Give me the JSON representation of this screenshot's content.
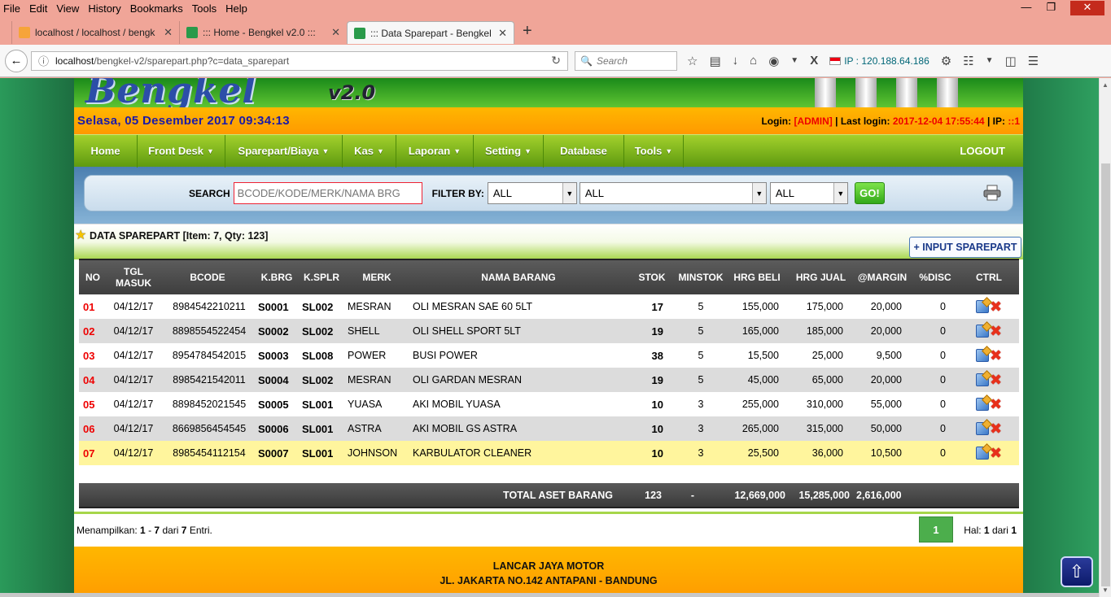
{
  "browser": {
    "menu": [
      "File",
      "Edit",
      "View",
      "History",
      "Bookmarks",
      "Tools",
      "Help"
    ],
    "tabs": [
      {
        "title": "localhost / localhost / bengk",
        "active": false
      },
      {
        "title": "::: Home - Bengkel v2.0 :::",
        "active": false
      },
      {
        "title": "::: Data Sparepart - Bengkel v",
        "active": true
      }
    ],
    "url_host": "localhost",
    "url_path": "/bengkel-v2/sparepart.php?c=data_sparepart",
    "search_placeholder": "Search",
    "ip_label": "IP : 120.188.64.186"
  },
  "header": {
    "logo": "Bengkel",
    "version": "v2.0",
    "datetime": "Selasa, 05 Desember 2017  09:34:13",
    "login_label": "Login:",
    "login_user": "[ADMIN]",
    "last_login_label": "| Last login:",
    "last_login": "2017-12-04 17:55:44",
    "ip_label": "| IP:",
    "ip": "::1"
  },
  "menu": {
    "items": [
      {
        "label": "Home",
        "dropdown": false
      },
      {
        "label": "Front Desk",
        "dropdown": true
      },
      {
        "label": "Sparepart/Biaya",
        "dropdown": true
      },
      {
        "label": "Kas",
        "dropdown": true
      },
      {
        "label": "Laporan",
        "dropdown": true
      },
      {
        "label": "Setting",
        "dropdown": true
      },
      {
        "label": "Database",
        "dropdown": false
      },
      {
        "label": "Tools",
        "dropdown": true
      }
    ],
    "logout": "LOGOUT"
  },
  "search": {
    "label": "SEARCH",
    "placeholder": "BCODE/KODE/MERK/NAMA BRG",
    "filter_label": "FILTER BY:",
    "filter1": "ALL",
    "filter2": "ALL",
    "filter3": "ALL",
    "go": "GO!"
  },
  "section": {
    "title": "DATA SPAREPART [Item: 7, Qty: 123]",
    "input_button": "+ INPUT SPAREPART"
  },
  "table": {
    "headers": [
      "NO",
      "TGL MASUK",
      "BCODE",
      "K.BRG",
      "K.SPLR",
      "MERK",
      "NAMA BARANG",
      "STOK",
      "MINSTOK",
      "HRG BELI",
      "HRG JUAL",
      "@MARGIN",
      "%DISC",
      "CTRL"
    ],
    "rows": [
      {
        "no": "01",
        "tgl": "04/12/17",
        "bcode": "8984542210211",
        "kbrg": "S0001",
        "ksplr": "SL002",
        "merk": "MESRAN",
        "nama": "OLI MESRAN SAE 60 5LT",
        "stok": "17",
        "minstok": "5",
        "beli": "155,000",
        "jual": "175,000",
        "margin": "20,000",
        "disc": "0"
      },
      {
        "no": "02",
        "tgl": "04/12/17",
        "bcode": "8898554522454",
        "kbrg": "S0002",
        "ksplr": "SL002",
        "merk": "SHELL",
        "nama": "OLI SHELL SPORT 5LT",
        "stok": "19",
        "minstok": "5",
        "beli": "165,000",
        "jual": "185,000",
        "margin": "20,000",
        "disc": "0"
      },
      {
        "no": "03",
        "tgl": "04/12/17",
        "bcode": "8954784542015",
        "kbrg": "S0003",
        "ksplr": "SL008",
        "merk": "POWER",
        "nama": "BUSI POWER",
        "stok": "38",
        "minstok": "5",
        "beli": "15,500",
        "jual": "25,000",
        "margin": "9,500",
        "disc": "0"
      },
      {
        "no": "04",
        "tgl": "04/12/17",
        "bcode": "8985421542011",
        "kbrg": "S0004",
        "ksplr": "SL002",
        "merk": "MESRAN",
        "nama": "OLI GARDAN MESRAN",
        "stok": "19",
        "minstok": "5",
        "beli": "45,000",
        "jual": "65,000",
        "margin": "20,000",
        "disc": "0"
      },
      {
        "no": "05",
        "tgl": "04/12/17",
        "bcode": "8898452021545",
        "kbrg": "S0005",
        "ksplr": "SL001",
        "merk": "YUASA",
        "nama": "AKI MOBIL YUASA",
        "stok": "10",
        "minstok": "3",
        "beli": "255,000",
        "jual": "310,000",
        "margin": "55,000",
        "disc": "0"
      },
      {
        "no": "06",
        "tgl": "04/12/17",
        "bcode": "8669856454545",
        "kbrg": "S0006",
        "ksplr": "SL001",
        "merk": "ASTRA",
        "nama": "AKI MOBIL GS ASTRA",
        "stok": "10",
        "minstok": "3",
        "beli": "265,000",
        "jual": "315,000",
        "margin": "50,000",
        "disc": "0"
      },
      {
        "no": "07",
        "tgl": "04/12/17",
        "bcode": "8985454112154",
        "kbrg": "S0007",
        "ksplr": "SL001",
        "merk": "JOHNSON",
        "nama": "KARBULATOR CLEANER",
        "stok": "10",
        "minstok": "3",
        "beli": "25,500",
        "jual": "36,000",
        "margin": "10,500",
        "disc": "0"
      }
    ],
    "total": {
      "label": "TOTAL ASET BARANG",
      "stok": "123",
      "minstok": "-",
      "beli": "12,669,000",
      "jual": "15,285,000",
      "margin": "2,616,000"
    }
  },
  "pagination": {
    "showing_prefix": "Menampilkan:",
    "from": "1",
    "to": "7",
    "of_label": "dari",
    "total": "7",
    "suffix": "Entri.",
    "current_page": "1",
    "hal_label": "Hal:",
    "hal_current": "1",
    "hal_of": "dari",
    "hal_total": "1"
  },
  "footer": {
    "line1": "LANCAR JAYA MOTOR",
    "line2": "JL. JAKARTA NO.142 ANTAPANI - BANDUNG"
  },
  "colors": {
    "menu_green": "#7cb518",
    "info_orange": "#ffa500",
    "accent_red": "#e00000",
    "datetime_blue": "#1a1aa8"
  }
}
